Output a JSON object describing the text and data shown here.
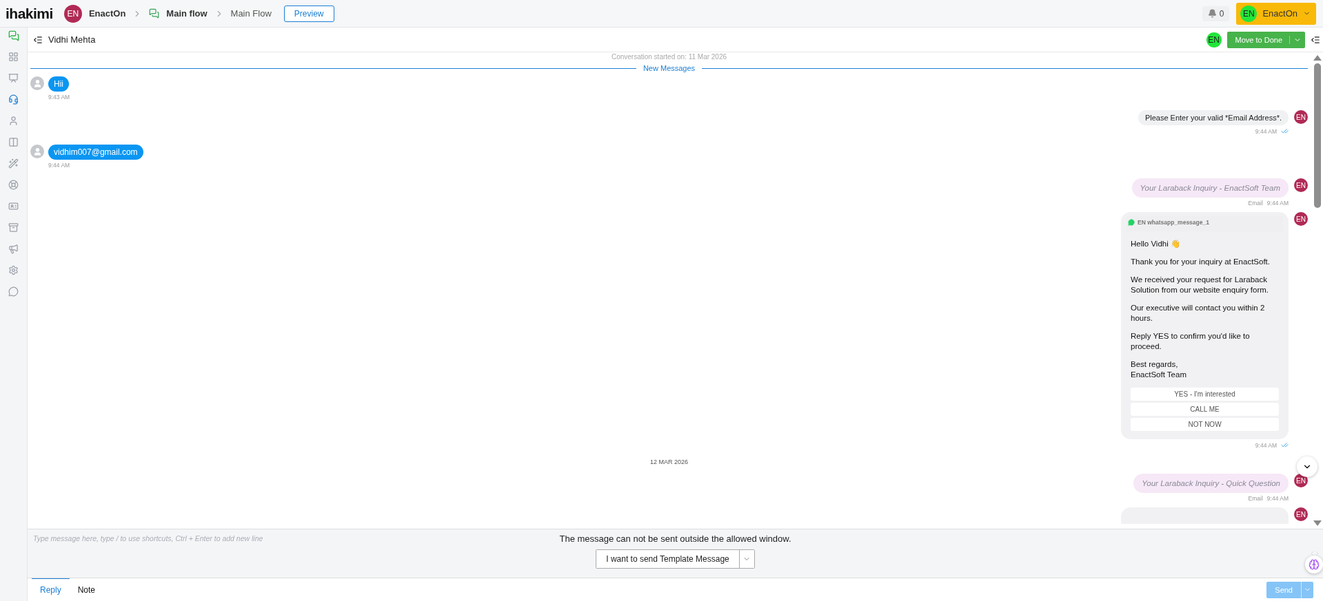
{
  "topbar": {
    "logo": "ihakimi",
    "org_avatar": "EN",
    "org_name": "EnactOn",
    "crumbs": [
      {
        "label": "Main flow",
        "current": false
      },
      {
        "label": "Main Flow",
        "current": true
      }
    ],
    "preview": "Preview",
    "notifications": "0",
    "user": {
      "avatar": "EN",
      "name": "EnactOn"
    }
  },
  "sidebar": {
    "items": [
      {
        "selected": false
      },
      {
        "selected": false
      },
      {
        "selected": true
      },
      {
        "selected": false
      },
      {
        "selected": false
      },
      {
        "selected": false
      },
      {
        "selected": false
      },
      {
        "selected": false
      },
      {
        "selected": false
      },
      {
        "selected": false
      },
      {
        "selected": false
      },
      {
        "selected": false
      }
    ]
  },
  "chat_header": {
    "contact": "Vidhi Mehta",
    "agent_avatar": "EN",
    "done_button": "Move to Done"
  },
  "messages": [
    {
      "kind": "notice",
      "text": "Conversation started on: 11 Mar 2026"
    },
    {
      "kind": "divider",
      "text": "New Messages"
    },
    {
      "kind": "incoming",
      "text": "Hii",
      "time": "9:43 AM"
    },
    {
      "kind": "outgoing",
      "text": "Please Enter your valid *Email Address*.",
      "time": "9:44 AM",
      "avatar": "EN",
      "read": true
    },
    {
      "kind": "incoming",
      "text": "vidhim007@gmail.com",
      "time": "9:44 AM"
    },
    {
      "kind": "email",
      "text": "Your Laraback Inquiry - EnactSoft Team",
      "channel": "Email",
      "time": "9:44 AM",
      "avatar": "EN"
    },
    {
      "kind": "template",
      "header": "EN whatsapp_message_1",
      "paragraphs": [
        "Hello Vidhi 👋",
        "Thank you for your inquiry at EnactSoft.",
        "We received your request for Laraback Solution from our website enquiry form.",
        "Our executive will contact you within 2 hours.",
        "Reply YES to confirm you'd like to proceed.",
        "Best regards,\nEnactSoft Team"
      ],
      "buttons": [
        "YES - I'm interested",
        "CALL ME",
        "NOT NOW"
      ],
      "time": "9:44 AM",
      "avatar": "EN",
      "read": true
    },
    {
      "kind": "date",
      "text": "12 MAR 2026"
    },
    {
      "kind": "email",
      "text": "Your Laraback Inquiry - Quick Question",
      "channel": "Email",
      "time": "9:44 AM",
      "avatar": "EN"
    },
    {
      "kind": "cut",
      "avatar": "EN"
    }
  ],
  "composer": {
    "placeholder": "Type message here, type / to use shortcuts, Ctrl + Enter to add new line",
    "notice": "The message can not be sent outside the allowed window.",
    "template_button": "I want to send Template Message"
  },
  "tabs": [
    {
      "label": "Reply",
      "selected": true
    },
    {
      "label": "Note",
      "selected": false
    }
  ],
  "send": {
    "label": "Send",
    "disabled": true
  }
}
